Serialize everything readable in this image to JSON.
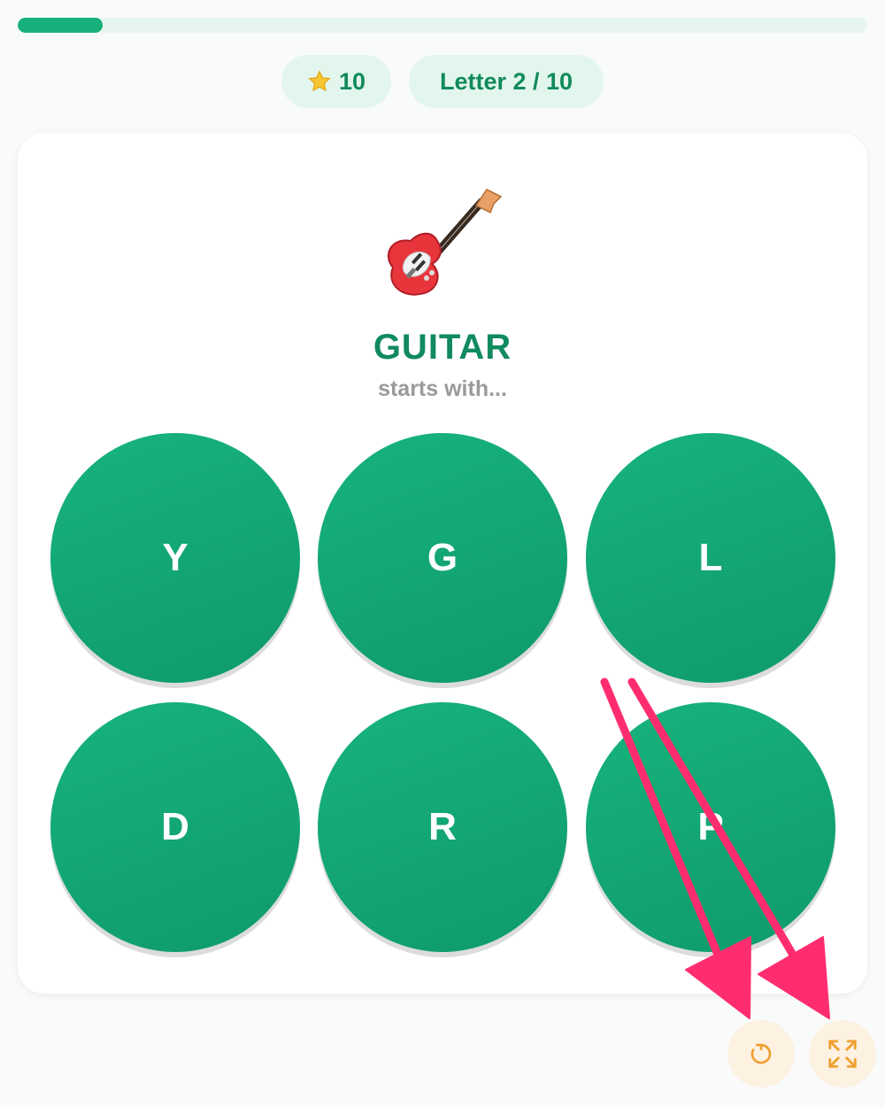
{
  "progress": {
    "fraction": 0.1,
    "color": "#17b07a",
    "track_color": "#e6f6ee"
  },
  "header": {
    "stars": {
      "icon": "star-icon",
      "value": "10"
    },
    "letter_counter": "Letter 2 / 10"
  },
  "question": {
    "emoji": "🎸",
    "emoji_icon": "guitar-icon",
    "word": "GUITAR",
    "prompt": "starts with..."
  },
  "options": [
    "Y",
    "G",
    "L",
    "D",
    "R",
    "P"
  ],
  "controls": {
    "restart_icon": "restart-icon",
    "fullscreen_icon": "fullscreen-icon"
  },
  "colors": {
    "accent": "#108a5e",
    "button": "#14a875",
    "control_bg": "#fdf1e2",
    "control_icon": "#f0a030",
    "annotation_arrow": "#ff2d70"
  }
}
